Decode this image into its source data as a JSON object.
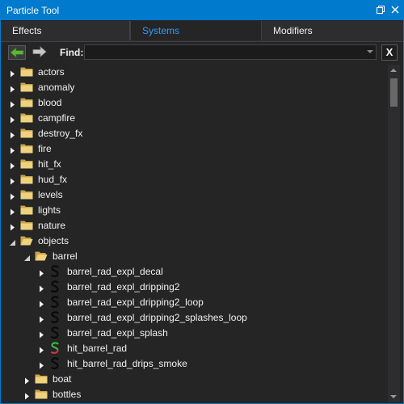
{
  "window": {
    "title": "Particle Tool"
  },
  "tabs": [
    {
      "label": "Effects",
      "active": false
    },
    {
      "label": "Systems",
      "active": true
    },
    {
      "label": "Modifiers",
      "active": false
    }
  ],
  "toolbar": {
    "find_label": "Find:",
    "find_value": "",
    "clear_label": "X"
  },
  "colors": {
    "accent": "#007acc",
    "tab_active_text": "#3399ff",
    "folder": "#e8c66a",
    "system_icon_green": "#3cc43c",
    "system_icon_red": "#d23a3a"
  },
  "tree": [
    {
      "label": "actors",
      "depth": 0,
      "type": "folder",
      "expanded": false
    },
    {
      "label": "anomaly",
      "depth": 0,
      "type": "folder",
      "expanded": false
    },
    {
      "label": "blood",
      "depth": 0,
      "type": "folder",
      "expanded": false
    },
    {
      "label": "campfire",
      "depth": 0,
      "type": "folder",
      "expanded": false
    },
    {
      "label": "destroy_fx",
      "depth": 0,
      "type": "folder",
      "expanded": false
    },
    {
      "label": "fire",
      "depth": 0,
      "type": "folder",
      "expanded": false
    },
    {
      "label": "hit_fx",
      "depth": 0,
      "type": "folder",
      "expanded": false
    },
    {
      "label": "hud_fx",
      "depth": 0,
      "type": "folder",
      "expanded": false
    },
    {
      "label": "levels",
      "depth": 0,
      "type": "folder",
      "expanded": false
    },
    {
      "label": "lights",
      "depth": 0,
      "type": "folder",
      "expanded": false
    },
    {
      "label": "nature",
      "depth": 0,
      "type": "folder",
      "expanded": false
    },
    {
      "label": "objects",
      "depth": 0,
      "type": "folder",
      "expanded": true
    },
    {
      "label": "barrel",
      "depth": 1,
      "type": "folder",
      "expanded": true
    },
    {
      "label": "barrel_rad_expl_decal",
      "depth": 2,
      "type": "system",
      "icon": "system-icon"
    },
    {
      "label": "barrel_rad_expl_dripping2",
      "depth": 2,
      "type": "system",
      "icon": "system-icon"
    },
    {
      "label": "barrel_rad_expl_dripping2_loop",
      "depth": 2,
      "type": "system",
      "icon": "system-icon"
    },
    {
      "label": "barrel_rad_expl_dripping2_splashes_loop",
      "depth": 2,
      "type": "system",
      "icon": "system-icon"
    },
    {
      "label": "barrel_rad_expl_splash",
      "depth": 2,
      "type": "system",
      "icon": "system-icon"
    },
    {
      "label": "hit_barrel_rad",
      "depth": 2,
      "type": "system",
      "icon": "system-icon-colored"
    },
    {
      "label": "hit_barrel_rad_drips_smoke",
      "depth": 2,
      "type": "system",
      "icon": "system-icon"
    },
    {
      "label": "boat",
      "depth": 1,
      "type": "folder",
      "expanded": false
    },
    {
      "label": "bottles",
      "depth": 1,
      "type": "folder",
      "expanded": false
    }
  ]
}
